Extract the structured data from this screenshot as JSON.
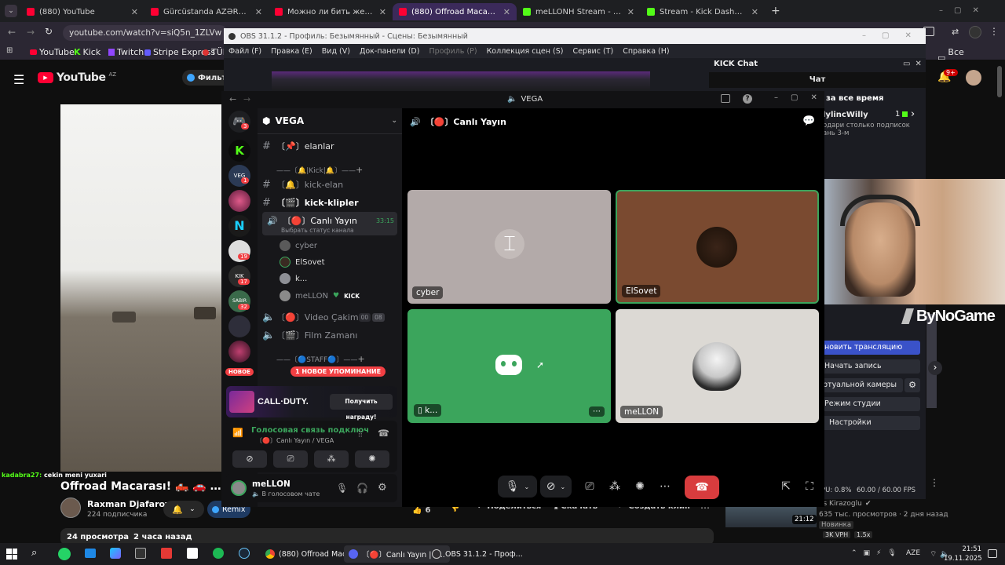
{
  "browser": {
    "tabs": [
      {
        "label": "(880) YouTube",
        "color": "#ff0033"
      },
      {
        "label": "Gürcüstanda AZƏRBAYCANLI K",
        "color": "#ff0033"
      },
      {
        "label": "Можно ли бить женщин?😂 |",
        "color": "#ff0033"
      },
      {
        "label": "(880) Offroad Macarası! 🛻 🚗",
        "color": "#ff0033"
      },
      {
        "label": "meLLONH Stream - Watch Live",
        "color": "#53fc18"
      },
      {
        "label": "Stream - Kick Dashboard",
        "color": "#53fc18"
      }
    ],
    "url": "youtube.com/watch?v=siQ5n_1ZLVw",
    "bookmarks": [
      "YouTube",
      "Kick",
      "Twitch",
      "Stripe Express",
      "TÜR"
    ],
    "all_bookmarks": "Все закладки"
  },
  "youtube": {
    "logo": "YouTube",
    "region": "AZ",
    "filter": "Фильтр",
    "notif_count": "9+",
    "overlay_comment_user": "kadabra27:",
    "overlay_comment_text": "cekin meni yuxari",
    "video_title": "Offroad Macarası! 🛻 🚗 ATV, Mot",
    "channel_name": "Raxman Djafarov",
    "subscribers": "224 подписчика",
    "remix": "Remix",
    "like_count": "6",
    "share": "Поделиться",
    "download": "Скачать",
    "clip": "Создать клип",
    "views": "24 просмотра",
    "posted": "2 часа назад",
    "side_views": "635 тыс. просмотров · 2 дня назад",
    "side_channel": "is Kirazoglu",
    "side_badge": "Новинка",
    "side_duration": "21:12",
    "side_vpn": "3K VPH",
    "side_speed": "1.5x"
  },
  "obs": {
    "title": "OBS 31.1.2 - Профиль: Безымянный - Сцены: Безымянный",
    "menu": [
      "Файл (F)",
      "Правка (E)",
      "Вид (V)",
      "Док-панели (D)",
      "Профиль (P)",
      "Коллекция сцен (S)",
      "Сервис (T)",
      "Справка (H)"
    ],
    "controls": [
      "новить трансляцию",
      "Начать запись",
      "ртуальной камеры",
      "Режим студии",
      "Настройки"
    ],
    "stats": "PU: 0.8%",
    "fps": "60.00 / 60.00 FPS",
    "brand": "ByNoGame"
  },
  "kick": {
    "title": "KICK Chat",
    "chat": "Чат",
    "all_time": "за все время",
    "top_user": "lylincWilly",
    "top_count": "1",
    "subtitle1": "одари столько подписок",
    "subtitle2": "ань 3-м"
  },
  "discord": {
    "window_title": "VEGA",
    "server_name": "VEGA",
    "servers_badges": [
      "3",
      "1",
      "19",
      "17",
      "32"
    ],
    "new_label": "НОВОЕ",
    "channels": [
      {
        "icon": "#",
        "name": "〔📌〕elanlar"
      },
      {
        "icon": "",
        "name": "——〔🔔|Kick|🔔〕——"
      },
      {
        "icon": "#",
        "name": "〔🔔〕kick-elan"
      },
      {
        "icon": "#",
        "name": "〔🎬〕kick-klipler"
      }
    ],
    "active_voice": "〔🔴〕Canlı Yayın",
    "active_voice_time": "33:15",
    "active_voice_status": "Выбрать статус канала",
    "voice_users": [
      {
        "name": "cyber",
        "color": "#5a5a5a"
      },
      {
        "name": "ElSovet",
        "color": "#3a2a22"
      },
      {
        "name": "k...",
        "color": "#5865f2"
      },
      {
        "name": "meLLON",
        "color": "#8a8a8a"
      }
    ],
    "kick_tag": "KICK",
    "other_voice": [
      {
        "name": "〔🔴〕Video Çakim",
        "a": "00",
        "b": "08"
      },
      {
        "name": "〔🎬〕Film Zamanı"
      }
    ],
    "staff": "——〔🔵STAFF🔵〕——",
    "new_mention": "1 НОВОЕ УПОМИНАНИЕ",
    "promo_game": "CALL·DUTY.",
    "promo_btn": "Получить награду!",
    "voice_connected": "Голосовая связь подключ",
    "voice_channel_path": "〔🔴〕Canlı Yayın / VEGA",
    "user_name": "meLLON",
    "user_status": "В голосовом чате",
    "header_channel": "〔🔴〕Canlı Yayın",
    "tiles": [
      {
        "label": "cyber",
        "bg": "#b3aaa9"
      },
      {
        "label": "ElSovet",
        "bg": "#7a4a30"
      },
      {
        "label": "k...",
        "bg": "#3ba55c"
      },
      {
        "label": "meLLON",
        "bg": "#dcd9d4"
      }
    ]
  },
  "taskbar": {
    "apps": [
      "(880) Offroad Maca...",
      "〔🔴〕Canlı Yayın | V...",
      "OBS 31.1.2 - Проф..."
    ],
    "lang": "AZE",
    "time": "21:51",
    "date": "19.11.2025"
  }
}
